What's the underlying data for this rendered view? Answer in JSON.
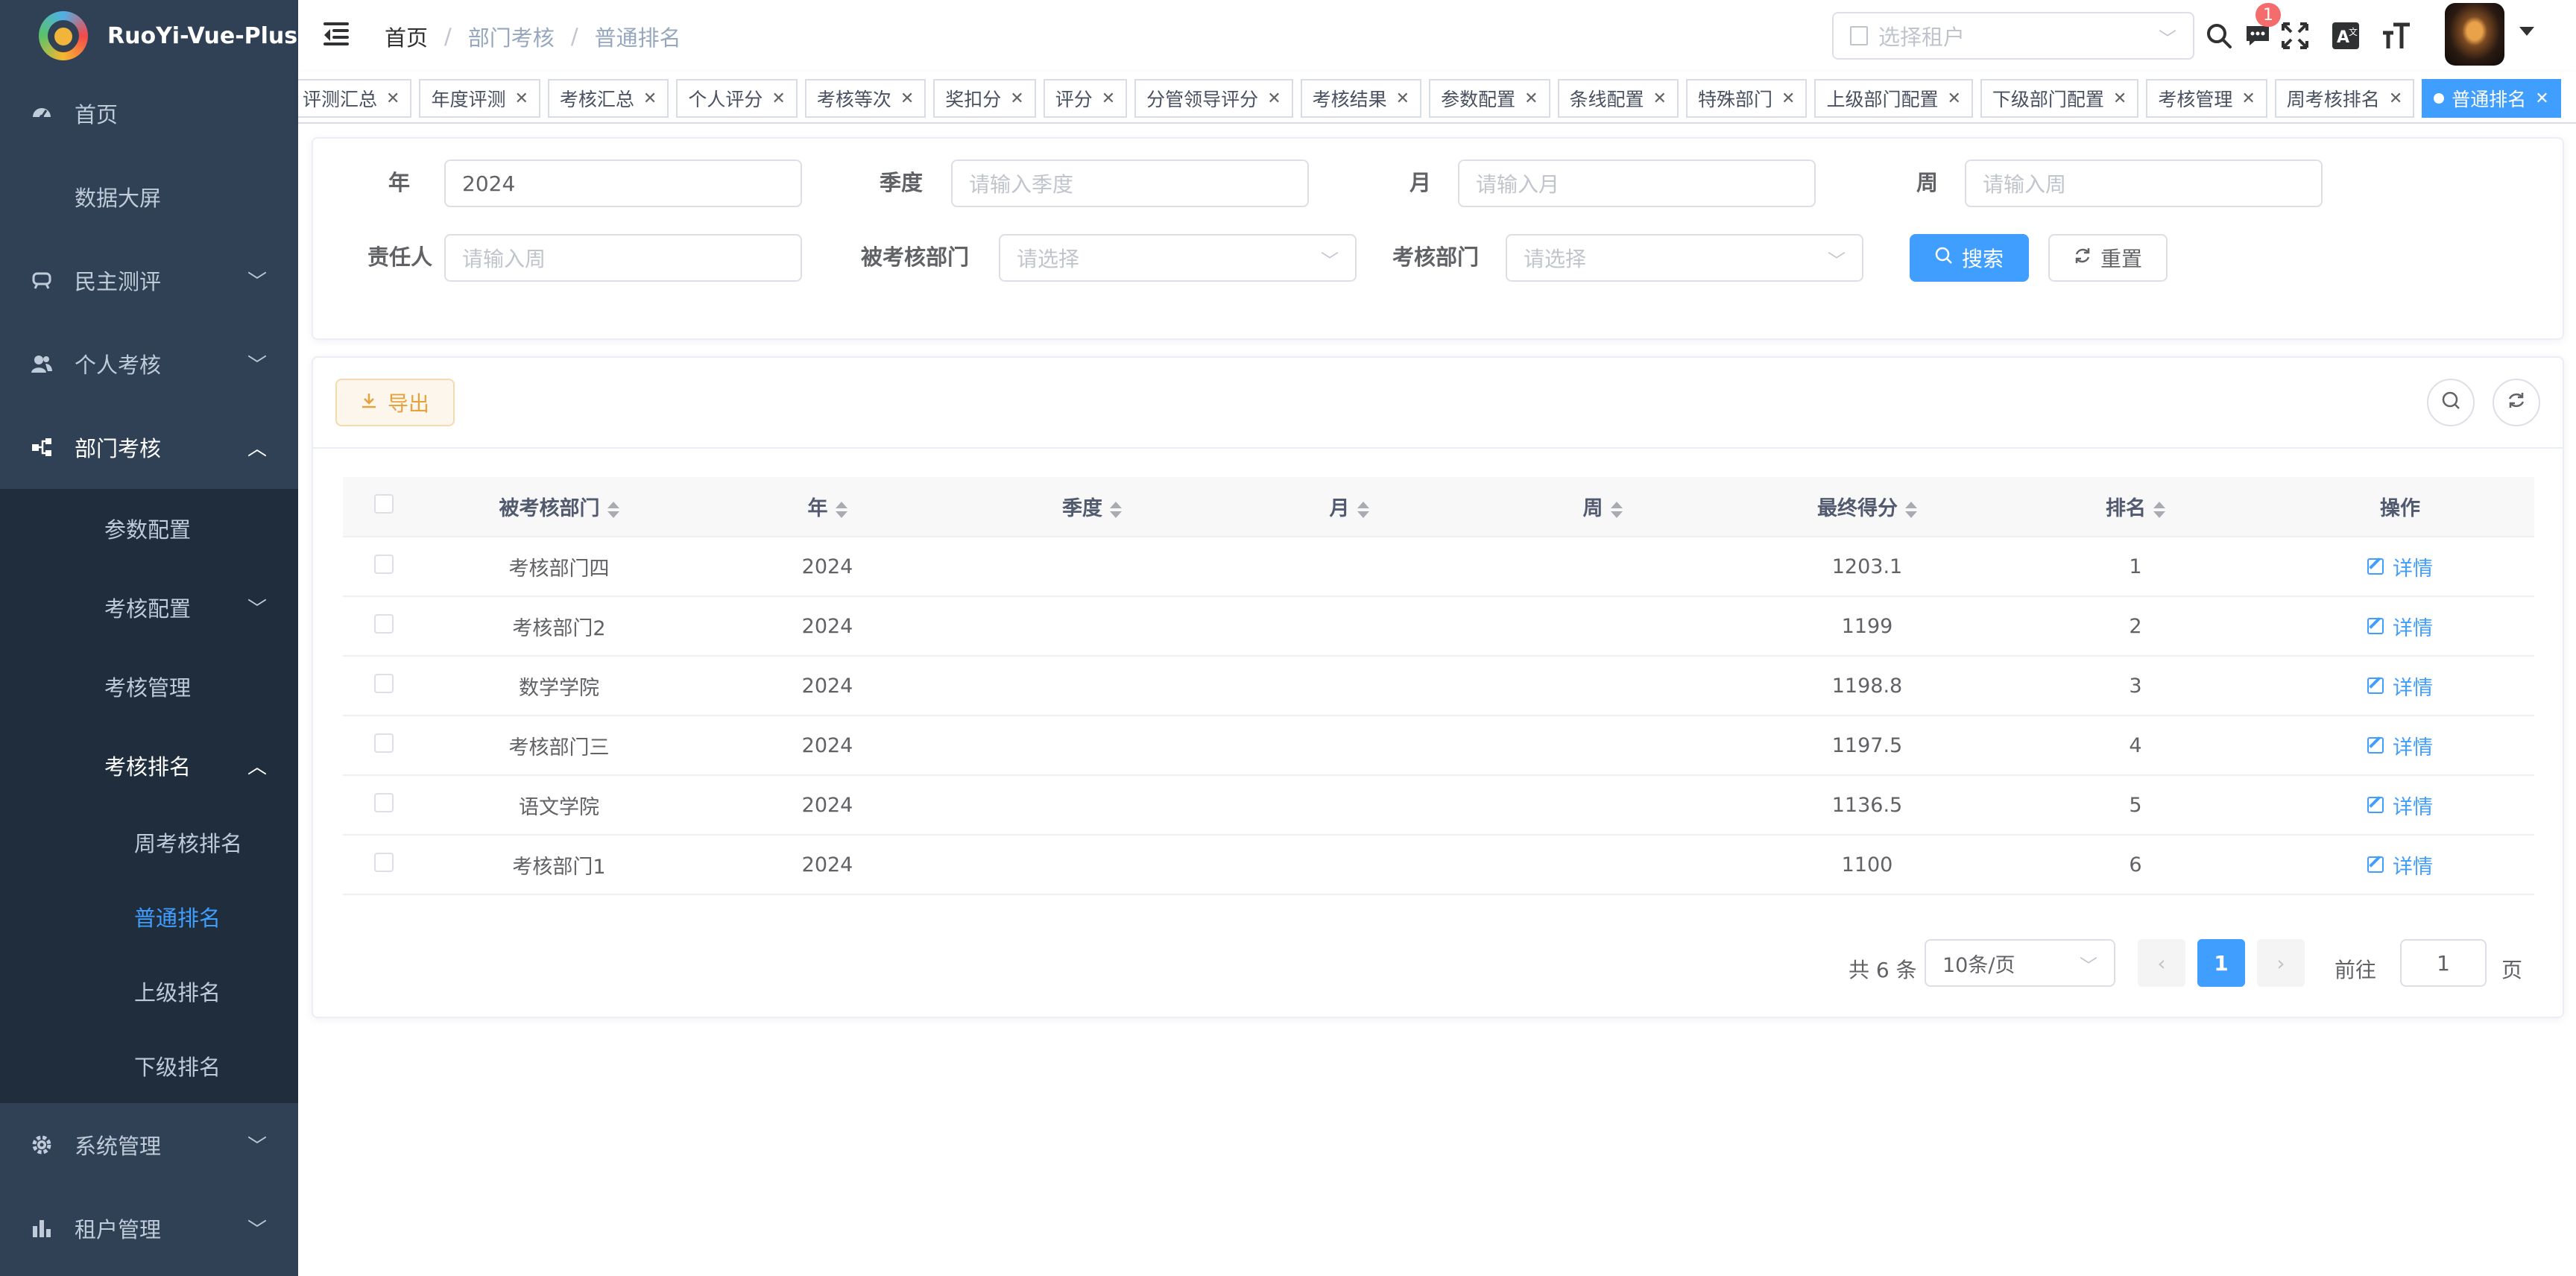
{
  "app": {
    "title": "RuoYi-Vue-Plus"
  },
  "sidebar": {
    "items": [
      {
        "label": "首页",
        "icon": "dashboard-icon"
      },
      {
        "label": "数据大屏"
      },
      {
        "label": "民主测评",
        "icon": "survey-icon"
      },
      {
        "label": "个人考核",
        "icon": "user-group-icon"
      },
      {
        "label": "部门考核",
        "icon": "tree-icon",
        "children": [
          {
            "label": "参数配置"
          },
          {
            "label": "考核配置"
          },
          {
            "label": "考核管理"
          },
          {
            "label": "考核排名",
            "children": [
              {
                "label": "周考核排名"
              },
              {
                "label": "普通排名",
                "active": true
              },
              {
                "label": "上级排名"
              },
              {
                "label": "下级排名"
              }
            ]
          }
        ]
      },
      {
        "label": "系统管理",
        "icon": "gear-icon"
      },
      {
        "label": "租户管理",
        "icon": "chart-icon"
      }
    ]
  },
  "navbar": {
    "breadcrumb": [
      "首页",
      "部门考核",
      "普通排名"
    ],
    "tenant_placeholder": "选择租户",
    "message_count": "1"
  },
  "tags": [
    "评测汇总",
    "年度评测",
    "考核汇总",
    "个人评分",
    "考核等次",
    "奖扣分",
    "评分",
    "分管领导评分",
    "考核结果",
    "参数配置",
    "条线配置",
    "特殊部门",
    "上级部门配置",
    "下级部门配置",
    "考核管理",
    "周考核排名",
    "普通排名"
  ],
  "active_tag": "普通排名",
  "search": {
    "year_label": "年",
    "year_value": "2024",
    "quarter_label": "季度",
    "quarter_placeholder": "请输入季度",
    "month_label": "月",
    "month_placeholder": "请输入月",
    "week_label": "周",
    "week_placeholder": "请输入周",
    "owner_label": "责任人",
    "owner_placeholder": "请输入周",
    "target_dept_label": "被考核部门",
    "target_dept_placeholder": "请选择",
    "dept_label": "考核部门",
    "dept_placeholder": "请选择",
    "search_button": "搜索",
    "reset_button": "重置"
  },
  "toolbar": {
    "export_label": "导出"
  },
  "table": {
    "headers": [
      "被考核部门",
      "年",
      "季度",
      "月",
      "周",
      "最终得分",
      "排名",
      "操作"
    ],
    "rows": [
      {
        "dept": "考核部门四",
        "year": "2024",
        "quarter": "",
        "month": "",
        "week": "",
        "score": "1203.1",
        "rank": "1",
        "action": "详情"
      },
      {
        "dept": "考核部门2",
        "year": "2024",
        "quarter": "",
        "month": "",
        "week": "",
        "score": "1199",
        "rank": "2",
        "action": "详情"
      },
      {
        "dept": "数学学院",
        "year": "2024",
        "quarter": "",
        "month": "",
        "week": "",
        "score": "1198.8",
        "rank": "3",
        "action": "详情"
      },
      {
        "dept": "考核部门三",
        "year": "2024",
        "quarter": "",
        "month": "",
        "week": "",
        "score": "1197.5",
        "rank": "4",
        "action": "详情"
      },
      {
        "dept": "语文学院",
        "year": "2024",
        "quarter": "",
        "month": "",
        "week": "",
        "score": "1136.5",
        "rank": "5",
        "action": "详情"
      },
      {
        "dept": "考核部门1",
        "year": "2024",
        "quarter": "",
        "month": "",
        "week": "",
        "score": "1100",
        "rank": "6",
        "action": "详情"
      }
    ]
  },
  "pagination": {
    "total_text": "共 6 条",
    "page_size": "10条/页",
    "current_page": "1",
    "goto_label": "前往",
    "goto_value": "1",
    "page_unit": "页"
  },
  "colors": {
    "primary": "#409eff",
    "sidebar_bg": "#304156",
    "sidebar_sub_bg": "#1f2d3d",
    "warning": "#e6a23c"
  }
}
